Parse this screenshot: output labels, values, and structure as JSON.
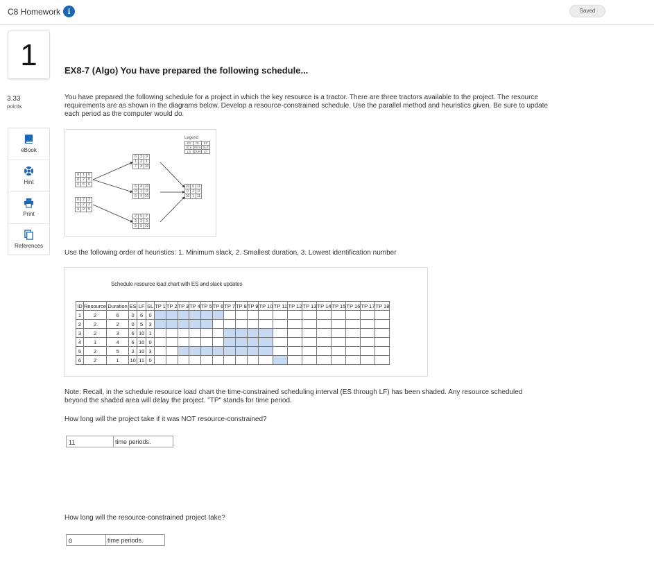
{
  "header": {
    "title": "C8 Homework",
    "info_icon": "info-icon",
    "status": "Saved"
  },
  "question": {
    "number": "1",
    "points_value": "3.33",
    "points_label": "points",
    "title": "EX8-7 (Algo) You have prepared the following schedule...",
    "description": "You have prepared the following schedule for a project in which the key resource is a tractor. There are three tractors available to the project. The resource requirements are as shown in the diagrams below. Develop a resource-constrained schedule. Use the parallel method and heuristics given. Be sure to update each period as the computer would do.",
    "heuristics": "Use the following order of heuristics: 1. Minimum slack, 2. Smallest duration, 3. Lowest identification number",
    "note": "Note: Recall, in the schedule resource load chart the time-constrained scheduling interval (ES through LF) has been shaded. Any resource scheduled beyond the shaded area will delay the project. \"TP\" stands for time period.",
    "q1_text": "How long will the project take if it was NOT resource-constrained?",
    "q1_value": "11",
    "q1_unit": "time periods.",
    "q2_text": "How long will the resource-constrained project take?",
    "q2_value": "0",
    "q2_unit": "time periods."
  },
  "tools": [
    {
      "label": "eBook",
      "icon": "book-icon"
    },
    {
      "label": "Hint",
      "icon": "lifebuoy-icon"
    },
    {
      "label": "Print",
      "icon": "printer-icon"
    },
    {
      "label": "References",
      "icon": "documents-icon"
    }
  ],
  "network": {
    "legend_title": "Legend",
    "legend": [
      [
        "ES",
        "ID",
        "EF"
      ],
      [
        "SLK",
        "RES",
        "SLK"
      ],
      [
        "LS",
        "DUR",
        "LF"
      ]
    ],
    "nodes": [
      {
        "id": "n1",
        "cells": [
          [
            "0",
            "1",
            "6"
          ],
          [
            "0",
            "2",
            "0"
          ],
          [
            "0",
            "6",
            "6"
          ]
        ]
      },
      {
        "id": "n2",
        "cells": [
          [
            "0",
            "2",
            "2"
          ],
          [
            "3",
            "2",
            "3"
          ],
          [
            "3",
            "2",
            "5"
          ]
        ]
      },
      {
        "id": "n3",
        "cells": [
          [
            "6",
            "3",
            "9"
          ],
          [
            "1",
            "2",
            "1"
          ],
          [
            "7",
            "3",
            "10"
          ]
        ]
      },
      {
        "id": "n4",
        "cells": [
          [
            "6",
            "4",
            "10"
          ],
          [
            "0",
            "1",
            "0"
          ],
          [
            "6",
            "4",
            "10"
          ]
        ]
      },
      {
        "id": "n5",
        "cells": [
          [
            "2",
            "5",
            "7"
          ],
          [
            "3",
            "2",
            "3"
          ],
          [
            "5",
            "5",
            "10"
          ]
        ]
      },
      {
        "id": "n6",
        "cells": [
          [
            "10",
            "6",
            "11"
          ],
          [
            "0",
            "2",
            "0"
          ],
          [
            "10",
            "1",
            "11"
          ]
        ]
      }
    ]
  },
  "chart_data": {
    "type": "table",
    "title": "Schedule resource load chart with ES and slack updates",
    "columns": [
      "ID",
      "Resource",
      "Duration",
      "ES",
      "LF",
      "SL",
      "TP 1",
      "TP 2",
      "TP 3",
      "TP 4",
      "TP 5",
      "TP 6",
      "TP 7",
      "TP 8",
      "TP 9",
      "TP 10",
      "TP 11",
      "TP 12",
      "TP 13",
      "TP 14",
      "TP 15",
      "TP 16",
      "TP 17",
      "TP 18"
    ],
    "rows": [
      {
        "id": "1",
        "resource": "2",
        "duration": "6",
        "es": "0",
        "lf": "6",
        "sl": "0",
        "shaded": [
          1,
          6
        ]
      },
      {
        "id": "2",
        "resource": "2",
        "duration": "2",
        "es": "0",
        "lf": "5",
        "sl": "3",
        "shaded": [
          1,
          5
        ]
      },
      {
        "id": "3",
        "resource": "2",
        "duration": "3",
        "es": "6",
        "lf": "10",
        "sl": "1",
        "shaded": [
          7,
          10
        ]
      },
      {
        "id": "4",
        "resource": "1",
        "duration": "4",
        "es": "6",
        "lf": "10",
        "sl": "0",
        "shaded": [
          7,
          10
        ]
      },
      {
        "id": "5",
        "resource": "2",
        "duration": "5",
        "es": "2",
        "lf": "10",
        "sl": "3",
        "shaded": [
          3,
          10
        ]
      },
      {
        "id": "6",
        "resource": "2",
        "duration": "1",
        "es": "10",
        "lf": "11",
        "sl": "0",
        "shaded": [
          11,
          11
        ]
      }
    ],
    "shade_color": "#c6d9f1"
  }
}
